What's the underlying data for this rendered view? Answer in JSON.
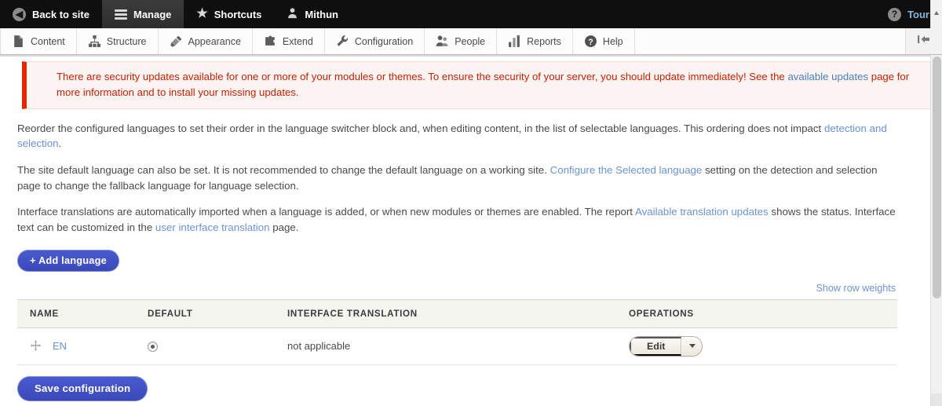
{
  "toolbar": {
    "back_to_site": "Back to site",
    "manage": "Manage",
    "shortcuts": "Shortcuts",
    "user": "Mithun",
    "tour": "Tour"
  },
  "admin_menu": {
    "items": [
      {
        "label": "Content",
        "icon": "page-icon"
      },
      {
        "label": "Structure",
        "icon": "structure-icon"
      },
      {
        "label": "Appearance",
        "icon": "brush-icon"
      },
      {
        "label": "Extend",
        "icon": "puzzle-icon"
      },
      {
        "label": "Configuration",
        "icon": "wrench-icon"
      },
      {
        "label": "People",
        "icon": "people-icon"
      },
      {
        "label": "Reports",
        "icon": "bar-chart-icon"
      },
      {
        "label": "Help",
        "icon": "question-circle-icon"
      }
    ],
    "collapse_label": "Collapse toolbar"
  },
  "message": {
    "text_before_link": "There are security updates available for one or more of your modules or themes. To ensure the security of your server, you should update immediately! See the ",
    "link": "available updates",
    "text_after_link": " page for more information and to install your missing updates."
  },
  "paragraphs": {
    "p1_a": "Reorder the configured languages to set their order in the language switcher block and, when editing content, in the list of selectable languages. This ordering does not impact ",
    "p1_link": "detection and selection",
    "p1_b": ".",
    "p2_a": "The site default language can also be set. It is not recommended to change the default language on a working site. ",
    "p2_link": "Configure the Selected language",
    "p2_b": " setting on the detection and selection page to change the fallback language for language selection.",
    "p3_a": "Interface translations are automatically imported when a language is added, or when new modules or themes are enabled. The report ",
    "p3_link": "Available translation updates",
    "p3_b": " shows the status. Interface text can be customized in the ",
    "p3_link2": "user interface translation",
    "p3_c": " page."
  },
  "actions": {
    "add_language": "+ Add language",
    "show_row_weights": "Show row weights",
    "save_configuration": "Save configuration"
  },
  "table": {
    "headers": [
      "NAME",
      "DEFAULT",
      "INTERFACE TRANSLATION",
      "OPERATIONS"
    ],
    "rows": [
      {
        "name": "EN",
        "default_selected": true,
        "interface_translation": "not applicable",
        "operation_label": "Edit"
      }
    ]
  },
  "colors": {
    "toolbar_bg": "#0f0f0f",
    "primary_button": "#4253c6",
    "link": "#6a93d4",
    "error_text": "#c72100",
    "error_border": "#e62600",
    "error_bg": "#fcf4f2",
    "table_header_bg": "#f5f5f0"
  }
}
